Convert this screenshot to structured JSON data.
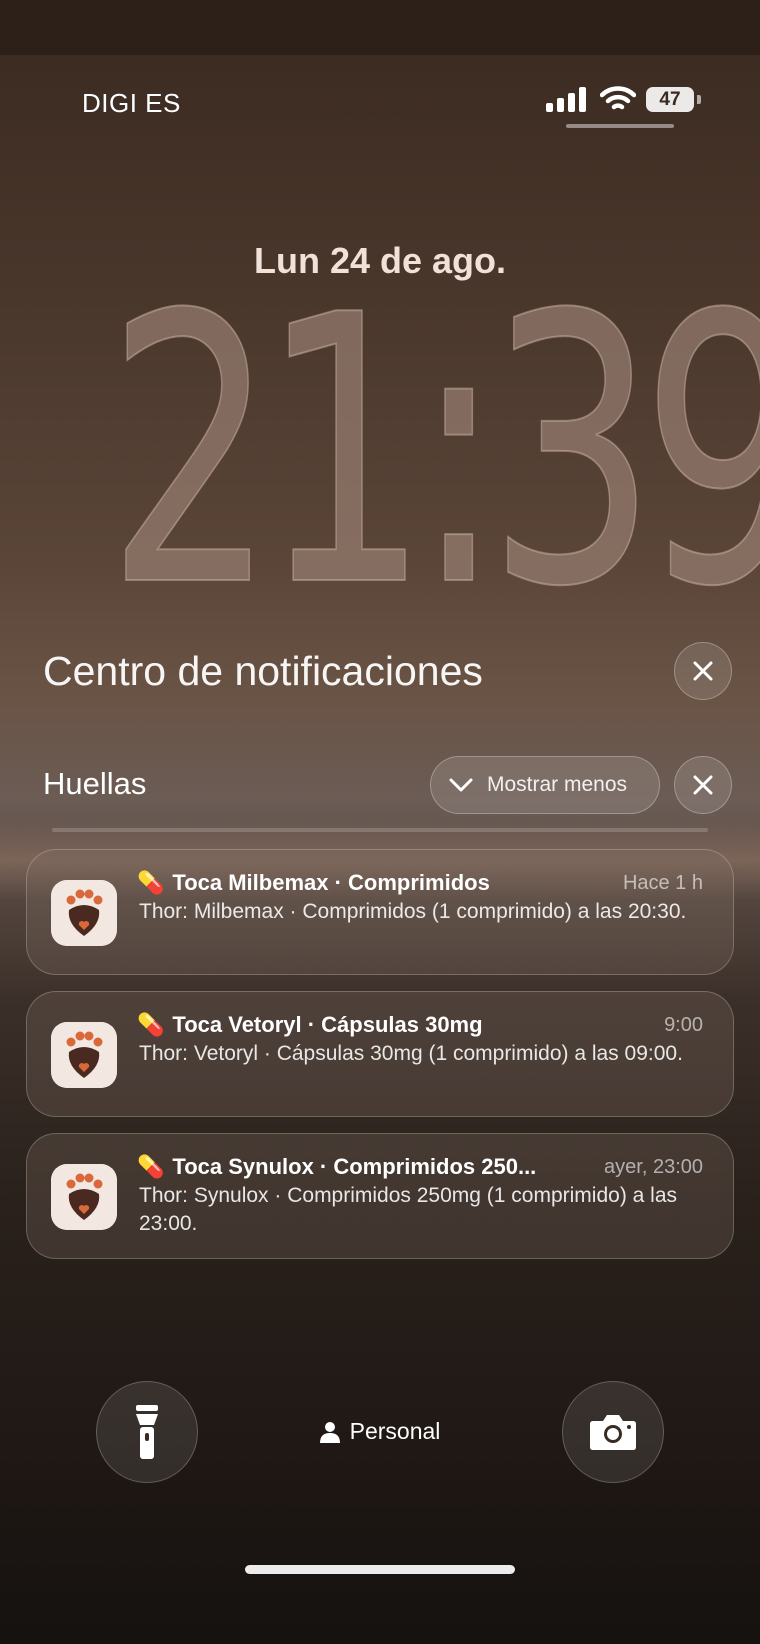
{
  "status_bar": {
    "carrier": "DIGI ES",
    "battery": "47",
    "icons": [
      "signal-icon",
      "wifi-icon",
      "battery-icon"
    ]
  },
  "lock": {
    "date": "Lun 24 de ago.",
    "time": "21:39"
  },
  "notification_center": {
    "title": "Centro de notificaciones",
    "group": {
      "app": "Huellas",
      "show_less": "Mostrar menos"
    },
    "notifications": [
      {
        "title": "Toca Milbemax · Comprimidos",
        "time": "Hace 1 h",
        "body": "Thor: Milbemax · Comprimidos (1 comprimido) a las 20:30.",
        "emoji": "💊"
      },
      {
        "title": "Toca Vetoryl · Cápsulas 30mg",
        "time": "9:00",
        "body": "Thor: Vetoryl · Cápsulas 30mg (1 comprimido) a las 09:00.",
        "emoji": "💊"
      },
      {
        "title": "Toca Synulox · Comprimidos 250...",
        "time": "ayer, 23:00",
        "body": "Thor: Synulox · Comprimidos 250mg (1 comprimido) a las 23:00.",
        "emoji": "💊"
      }
    ]
  },
  "bottom": {
    "focus_label": "Personal"
  },
  "colors": {
    "icon_brown": "#4a2a20",
    "icon_orange": "#d9683a",
    "icon_bg": "#f2e8e1"
  }
}
